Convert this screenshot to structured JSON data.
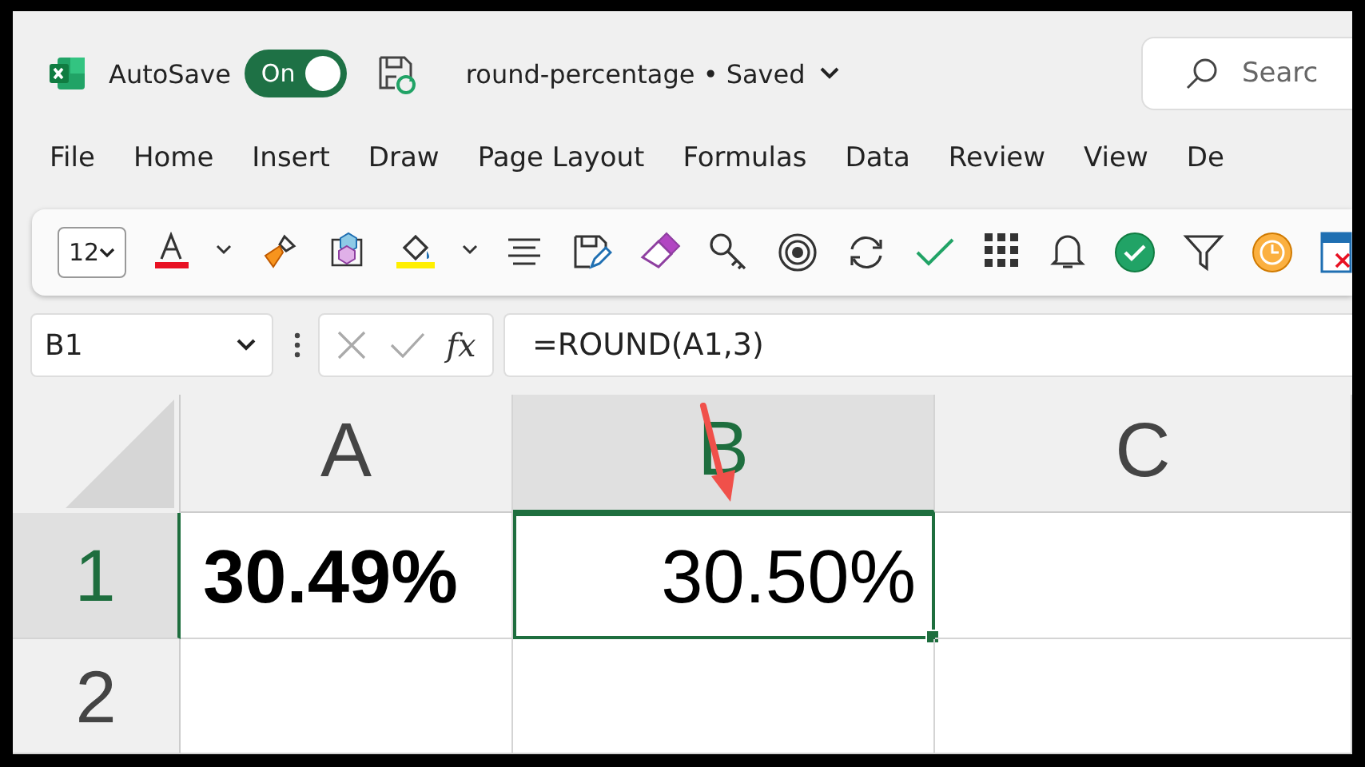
{
  "title_bar": {
    "autosave_label": "AutoSave",
    "autosave_on": true,
    "toggle_text": "On",
    "document_title": "round-percentage • Saved",
    "search_placeholder": "Searc"
  },
  "ribbon_tabs": [
    {
      "label": "File"
    },
    {
      "label": "Home"
    },
    {
      "label": "Insert"
    },
    {
      "label": "Draw"
    },
    {
      "label": "Page Layout"
    },
    {
      "label": "Formulas"
    },
    {
      "label": "Data"
    },
    {
      "label": "Review"
    },
    {
      "label": "View"
    },
    {
      "label": "De"
    }
  ],
  "toolbar": {
    "font_size": "12"
  },
  "formula_bar": {
    "name_box": "B1",
    "fx": "fx",
    "formula": "=ROUND(A1,3)"
  },
  "sheet": {
    "columns": [
      {
        "label": "A",
        "selected": false
      },
      {
        "label": "B",
        "selected": true
      },
      {
        "label": "C",
        "selected": false
      }
    ],
    "rows": [
      {
        "label": "1",
        "selected": true,
        "cells": [
          {
            "value": "30.49%",
            "bold": true,
            "right_aligned": false,
            "selected": false
          },
          {
            "value": "30.50%",
            "bold": false,
            "right_aligned": true,
            "selected": true
          },
          {
            "selected": false
          }
        ]
      },
      {
        "label": "2",
        "selected": false,
        "cells": [
          {
            "selected": false
          },
          {
            "selected": false
          },
          {
            "selected": false
          }
        ]
      }
    ]
  }
}
